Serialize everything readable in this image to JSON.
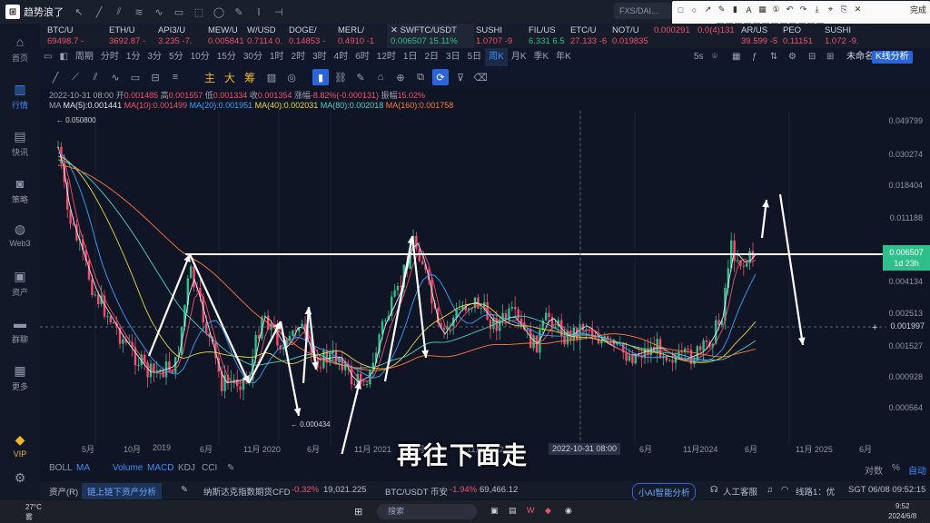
{
  "app": {
    "title": "趋势浪了"
  },
  "search": {
    "text": "FXS/DAI..."
  },
  "annotation_toolbar": {
    "done_label": "完成",
    "colors": [
      "#e53935",
      "#fb8c00",
      "#fdd835",
      "#43a047",
      "#1e88e5",
      "#8e24aa",
      "#000000",
      "#ffffff",
      "#e91e63",
      "#00acc1",
      "#7cb342",
      "#6d4c41"
    ]
  },
  "sidebar": {
    "items": [
      {
        "label": "首页",
        "icon": "home-icon"
      },
      {
        "label": "行情",
        "icon": "chart-bars-icon"
      },
      {
        "label": "快讯",
        "icon": "news-icon"
      },
      {
        "label": "策略",
        "icon": "robot-icon"
      },
      {
        "label": "Web3",
        "icon": "web3-icon"
      },
      {
        "label": "资产",
        "icon": "wallet-icon"
      },
      {
        "label": "群聊",
        "icon": "chat-icon"
      },
      {
        "label": "更多",
        "icon": "grid-icon"
      },
      {
        "label": "VIP",
        "icon": "vip-icon"
      },
      {
        "label": "",
        "icon": "settings-icon"
      }
    ]
  },
  "tickers": [
    {
      "name": "BTC/U",
      "price": "69498.7",
      "chg": "-"
    },
    {
      "name": "ETH/U",
      "price": "3692.87",
      "chg": "-"
    },
    {
      "name": "API3/U",
      "price": "3.235",
      "chg": "-7."
    },
    {
      "name": "MEW/U",
      "price": "0.005841",
      "chg": ""
    },
    {
      "name": "W/USD",
      "price": "0.7114",
      "chg": "0."
    },
    {
      "name": "DOGE/",
      "price": "0.14853",
      "chg": "-"
    },
    {
      "name": "MERL/",
      "price": "0.4910",
      "chg": "-1"
    },
    {
      "name": "SWFTC/USDT",
      "price": "0.006507",
      "chg": "15.11%"
    },
    {
      "name": "SUSHI",
      "price": "1.0707",
      "chg": "-9"
    },
    {
      "name": "FIL/US",
      "price": "6.331",
      "chg": "6.5"
    },
    {
      "name": "ETC/U",
      "price": "27.133",
      "chg": "-6"
    },
    {
      "name": "NOT/U",
      "price": "0.019835",
      "chg": ""
    },
    {
      "name": "",
      "price": "0.000291",
      "chg": ""
    },
    {
      "name": "",
      "price": "0.0(4)131",
      "chg": ""
    },
    {
      "name": "AR/US",
      "price": "39.599",
      "chg": "-5"
    },
    {
      "name": "PEO",
      "price": "0.11151",
      "chg": ""
    },
    {
      "name": "SUSHI",
      "price": "1.072",
      "chg": "-9."
    }
  ],
  "periods": [
    "周期",
    "分时",
    "1分",
    "3分",
    "5分",
    "10分",
    "15分",
    "30分",
    "1时",
    "2时",
    "3时",
    "4时",
    "6时",
    "12时",
    "1日",
    "2日",
    "3日",
    "5日",
    "周K",
    "月K",
    "季K",
    "年K"
  ],
  "selected_period": "周K",
  "right_controls": {
    "interval": "5s",
    "layout_name": "未命名",
    "analysis_button": "K线分析"
  },
  "draw_tools": {
    "main": "主",
    "big": "大",
    "chou": "筹"
  },
  "ohlc": {
    "date": "2022-10-31 08:00",
    "open_label": "开",
    "open": "0.001485",
    "high_label": "高",
    "high": "0.001557",
    "low_label": "低",
    "low": "0.001334",
    "close_label": "收",
    "close": "0.001354",
    "change_label": "涨幅",
    "change": "-8.82%(-0.000131)",
    "amp_label": "振幅",
    "amp": "15.02%"
  },
  "ma": [
    {
      "label": "MA(5):0.001441",
      "color": "#e3e6ee"
    },
    {
      "label": "MA(10):0.001499",
      "color": "#f0506e"
    },
    {
      "label": "MA(20):0.001951",
      "color": "#3aa0ff"
    },
    {
      "label": "MA(40):0.002031",
      "color": "#e9d84a"
    },
    {
      "label": "MA(80):0.002018",
      "color": "#4fd1c5"
    },
    {
      "label": "MA(160):0.001758",
      "color": "#ff7a3d"
    }
  ],
  "ma_prefix": "MA",
  "chart_data": {
    "type": "candlestick",
    "scale": "log",
    "yticks": [
      "0.049799",
      "0.030274",
      "0.018404",
      "0.011188",
      "0.006507",
      "0.004134",
      "0.002513",
      "0.001997",
      "0.001527",
      "0.000928",
      "0.000564"
    ],
    "xticks": [
      "5月",
      "10月",
      "2019",
      "6月",
      "11月 2020",
      "6月",
      "11月 2021",
      "6月",
      "11月 2022",
      "6月",
      "11月2024",
      "6月",
      "11月 2025",
      "6月"
    ],
    "high_annotation": "← 0.050800",
    "low_annotation": "← 0.000434",
    "last_price": "0.006507",
    "countdown": "1d 23h",
    "crosshair_price": "0.001997",
    "crosshair_date": "2022-10-31 08:00"
  },
  "indicators": [
    "BOLL",
    "MA",
    "Volume",
    "MACD",
    "KDJ",
    "CCI"
  ],
  "active_indicators": [
    "MA",
    "Volume",
    "MACD"
  ],
  "scale_options": [
    "对数",
    "%",
    "自动"
  ],
  "subtitle": "再往下面走",
  "status": {
    "asset": "资产(R)",
    "onchain": "链上链下资产分析",
    "cfd_name": "纳斯达克指数期货CFD",
    "cfd_chg": "-0.32%",
    "cfd_price": "19,021.225",
    "btc_name": "BTC/USDT 币安",
    "btc_chg": "-1.94%",
    "btc_price": "69,466.12",
    "ai": "小AI智能分析",
    "service": "人工客服",
    "line": "线路1：优",
    "clock": "SGT 06/08 09:52:15"
  },
  "taskbar": {
    "weather": "27°C",
    "weather_sub": "雾",
    "search": "搜索",
    "time": "9:52",
    "date": "2024/6/8"
  }
}
